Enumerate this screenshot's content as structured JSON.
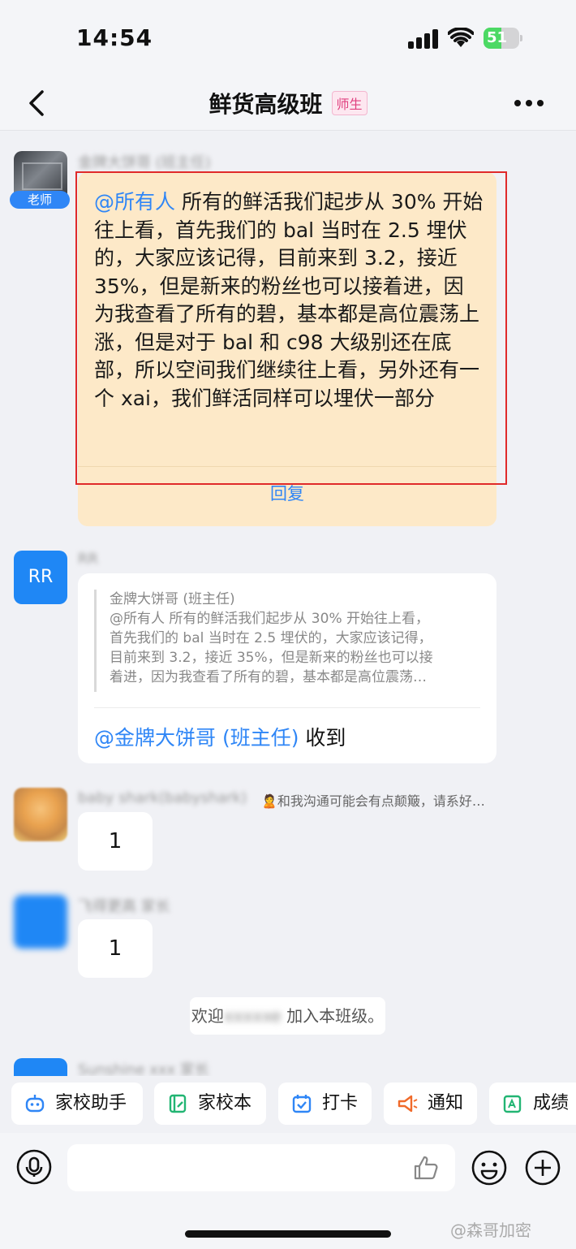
{
  "status_bar": {
    "time": "14:54",
    "battery_level": "51"
  },
  "header": {
    "title": "鲜货高级班",
    "badge": "师生"
  },
  "messages": {
    "teacher": {
      "name": "金牌大饼哥 (班主任)",
      "role_tag": "老师",
      "mention": "@所有人",
      "text": " 所有的鲜活我们起步从 30% 开始往上看，首先我们的 bal 当时在 2.5 埋伏的，大家应该记得，目前来到 3.2，接近 35%，但是新来的粉丝也可以接着进，因为我查看了所有的碧，基本都是高位震荡上涨，但是对于 bal 和 c98 大级别还在底部，所以空间我们继续往上看，另外还有一个 xai，我们鲜活同样可以埋伏一部分",
      "reply_label": "回复"
    },
    "rr": {
      "avatar_text": "RR",
      "name": "RR",
      "quote_author": "金牌大饼哥 (班主任)",
      "quote_lines": [
        "@所有人 所有的鲜活我们起步从 30% 开始往上看，",
        "首先我们的 bal 当时在 2.5 埋伏的，大家应该记得，",
        "目前来到 3.2，接近 35%，但是新来的粉丝也可以接",
        "着进，因为我查看了所有的碧，基本都是高位震荡…"
      ],
      "reply_mention": "@金牌大饼哥 (班主任)",
      "reply_text": " 收到"
    },
    "baby": {
      "name": "baby shark(babyshark)",
      "tagline": "🙎和我沟通可能会有点颠簸，请系好…",
      "text": "1"
    },
    "third": {
      "name": "飞得更高 家长",
      "text": "1"
    },
    "system": {
      "prefix": "欢迎",
      "blurred": "xxxxxe",
      "suffix": " 加入本班级。"
    },
    "partial": {
      "name": "Sunshine xxx 家长"
    }
  },
  "quick_actions": [
    {
      "label": "家校助手",
      "icon": "robot-icon",
      "color": "#2f86f6"
    },
    {
      "label": "家校本",
      "icon": "notebook-icon",
      "color": "#22b573"
    },
    {
      "label": "打卡",
      "icon": "calendar-check-icon",
      "color": "#2f86f6"
    },
    {
      "label": "通知",
      "icon": "megaphone-icon",
      "color": "#f06a2a"
    },
    {
      "label": "成绩",
      "icon": "grade-icon",
      "color": "#22b573"
    }
  ],
  "input": {
    "placeholder": ""
  },
  "watermark": "@森哥加密"
}
